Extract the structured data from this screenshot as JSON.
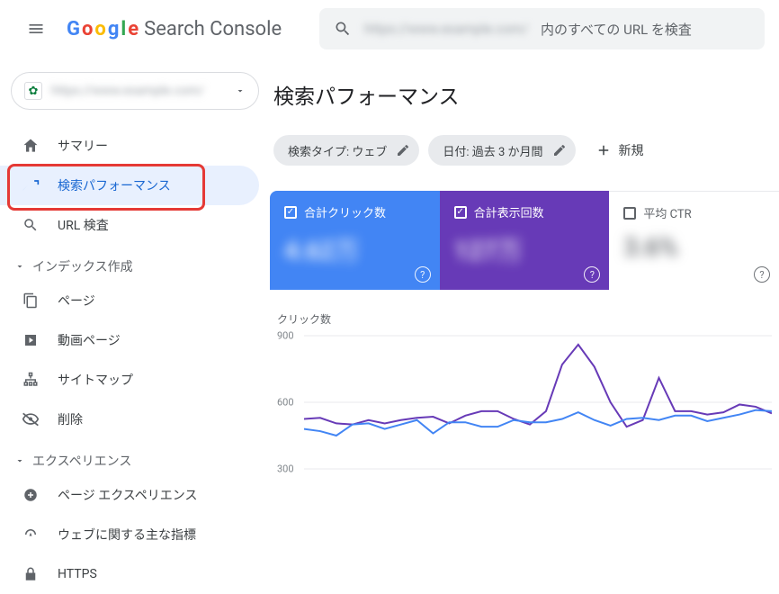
{
  "app": {
    "title": "Search Console"
  },
  "search": {
    "placeholder_suffix": "内のすべての URL を検査",
    "blurred_prefix": "https://www.example.com/"
  },
  "property": {
    "display": "https://www.example.com/"
  },
  "nav": {
    "summary": "サマリー",
    "performance": "検索パフォーマンス",
    "url_inspect": "URL 検査",
    "section_index": "インデックス作成",
    "pages": "ページ",
    "video_pages": "動画ページ",
    "sitemaps": "サイトマップ",
    "removals": "削除",
    "section_experience": "エクスペリエンス",
    "page_experience": "ページ エクスペリエンス",
    "core_web_vitals": "ウェブに関する主な指標",
    "https": "HTTPS"
  },
  "page_title": "検索パフォーマンス",
  "filters": {
    "search_type": "検索タイプ: ウェブ",
    "date": "日付: 過去 3 か月間",
    "new": "新規"
  },
  "cards": {
    "clicks": {
      "label": "合計クリック数",
      "value": "4.62万"
    },
    "impressions": {
      "label": "合計表示回数",
      "value": "127万"
    },
    "ctr": {
      "label": "平均 CTR",
      "value": "3.6%"
    }
  },
  "chart": {
    "label": "クリック数",
    "y_ticks": [
      "900",
      "600",
      "300"
    ]
  },
  "chart_data": {
    "type": "line",
    "ylim": [
      0,
      900
    ],
    "ylabel": "クリック数",
    "series": [
      {
        "name": "合計表示回数",
        "color": "#673ab7",
        "values": [
          525,
          530,
          505,
          500,
          520,
          505,
          520,
          530,
          535,
          505,
          540,
          560,
          560,
          525,
          500,
          560,
          770,
          860,
          760,
          600,
          490,
          520,
          710,
          560,
          560,
          545,
          555,
          590,
          580,
          550
        ]
      },
      {
        "name": "合計クリック数",
        "color": "#4285f4",
        "values": [
          480,
          470,
          450,
          500,
          505,
          480,
          500,
          520,
          460,
          510,
          510,
          490,
          490,
          520,
          510,
          510,
          525,
          555,
          520,
          495,
          525,
          530,
          520,
          540,
          540,
          515,
          530,
          545,
          565,
          560
        ]
      }
    ]
  }
}
